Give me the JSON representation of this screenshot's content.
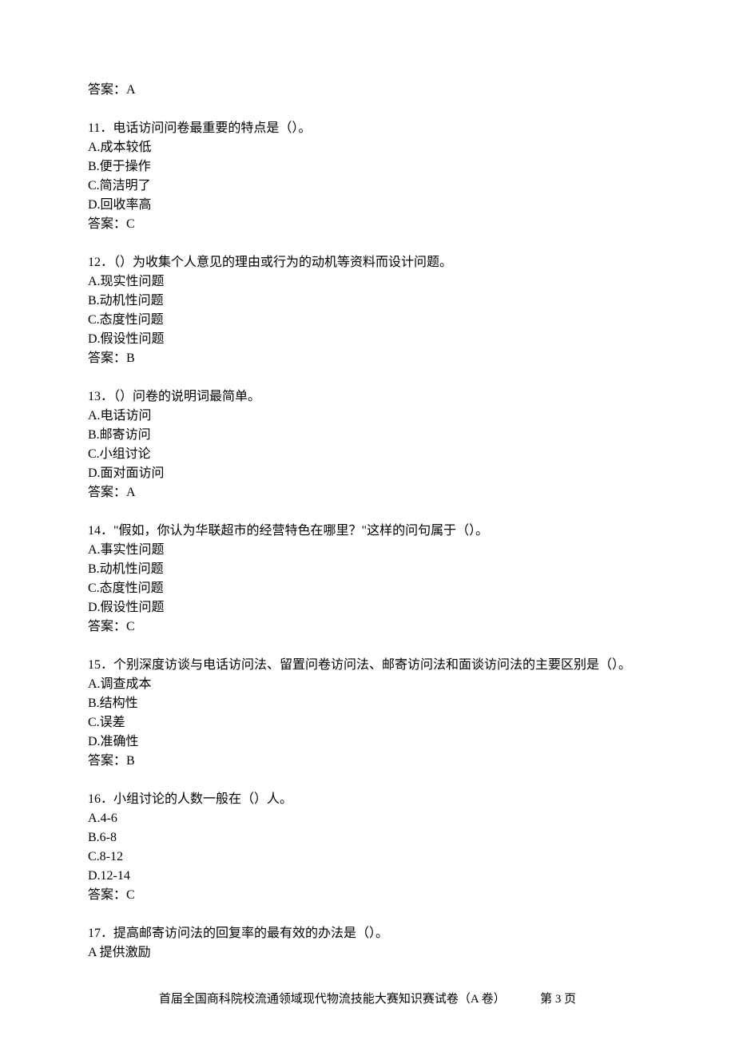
{
  "answerPrefix": "答案：",
  "topAnswer": "答案：A",
  "questions": [
    {
      "stem": "11．电话访问问卷最重要的特点是（）。",
      "options": [
        "A.成本较低",
        "B.便于操作",
        "C.简洁明了",
        "D.回收率高"
      ],
      "answer": "答案：C"
    },
    {
      "stem": "12．（）为收集个人意见的理由或行为的动机等资料而设计问题。",
      "options": [
        "A.现实性问题",
        "B.动机性问题",
        "C.态度性问题",
        "D.假设性问题"
      ],
      "answer": "答案：B"
    },
    {
      "stem": "13．（）问卷的说明词最简单。",
      "options": [
        "A.电话访问",
        "B.邮寄访问",
        "C.小组讨论",
        "D.面对面访问"
      ],
      "answer": "答案：A"
    },
    {
      "stem": "14．\"假如，你认为华联超市的经营特色在哪里？\"这样的问句属于（）。",
      "options": [
        "A.事实性问题",
        "B.动机性问题",
        "C.态度性问题",
        "D.假设性问题"
      ],
      "answer": "答案：C"
    },
    {
      "stem": "15．个别深度访谈与电话访问法、留置问卷访问法、邮寄访问法和面谈访问法的主要区别是（）。",
      "options": [
        "A.调查成本",
        "B.结构性",
        "C.误差",
        "D.准确性"
      ],
      "answer": "答案：B"
    },
    {
      "stem": "16．小组讨论的人数一般在（）人。",
      "options": [
        "A.4-6",
        "B.6-8",
        "C.8-12",
        "D.12-14"
      ],
      "answer": "答案：C"
    },
    {
      "stem": "17．提高邮寄访问法的回复率的最有效的办法是（）。",
      "options": [
        "A 提供激励"
      ],
      "answer": null
    }
  ],
  "footer": {
    "title": "首届全国商科院校流通领域现代物流技能大赛知识赛试卷（A 卷）",
    "page": "第 3 页"
  }
}
